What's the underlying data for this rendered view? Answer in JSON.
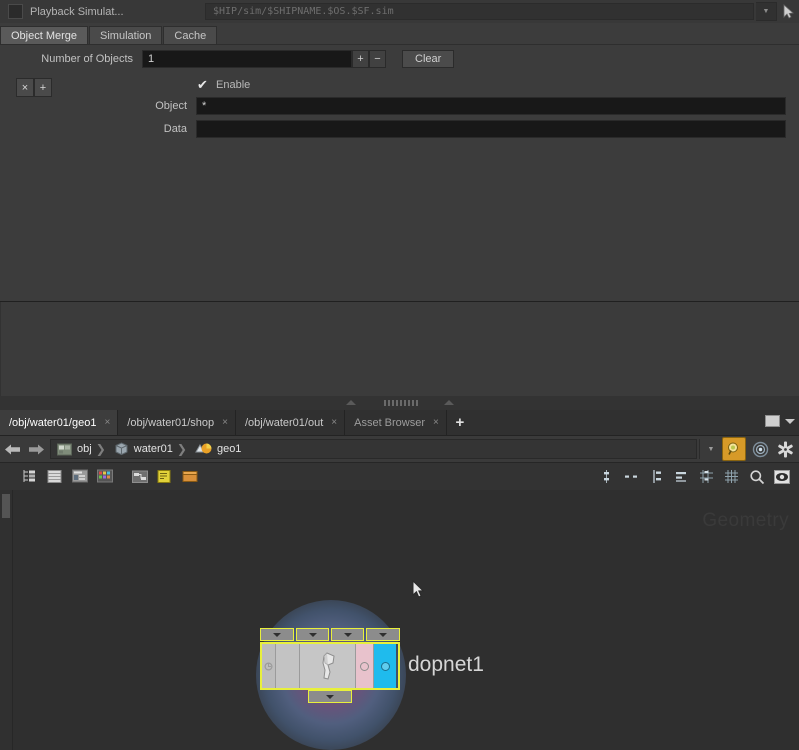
{
  "parameter_editor": {
    "node": {
      "color_swatch": "#2b2b2b",
      "name": "Playback Simulat...",
      "path_value": "$HIP/sim/$SHIPNAME.$OS.$SF.sim",
      "dropdown_icon": "chevron-down-icon",
      "picker_icon": "node-picker-icon"
    },
    "tabs": [
      {
        "label": "Object Merge",
        "active": true
      },
      {
        "label": "Simulation",
        "active": false
      },
      {
        "label": "Cache",
        "active": false
      }
    ],
    "rows": {
      "number_of_objects": {
        "label": "Number of Objects",
        "value": "1",
        "increment_label": "+",
        "decrement_label": "−",
        "clear_label": "Clear"
      },
      "multiparm": {
        "remove_label": "×",
        "add_label": "+"
      },
      "enable": {
        "label": "Enable",
        "checked_glyph": "✔",
        "checked": true
      },
      "object": {
        "label": "Object",
        "value": "*"
      },
      "data": {
        "label": "Data",
        "value": ""
      }
    }
  },
  "network_editor": {
    "tabs": [
      {
        "label": "/obj/water01/geo1",
        "active": true,
        "close_glyph": "×"
      },
      {
        "label": "/obj/water01/shop",
        "active": false,
        "close_glyph": "×"
      },
      {
        "label": "/obj/water01/out",
        "active": false,
        "close_glyph": "×"
      },
      {
        "label": "Asset Browser",
        "active": false,
        "close_glyph": "×"
      }
    ],
    "new_tab_label": "+",
    "window_controls": {
      "maximize_icon": "maximize-icon",
      "menu_icon": "chevron-down-icon"
    },
    "path_bar": {
      "back_icon": "arrow-left-icon",
      "forward_icon": "arrow-right-icon",
      "breadcrumb": [
        {
          "label": "obj",
          "icon": "obj-network-icon"
        },
        {
          "label": "water01",
          "icon": "geometry-object-icon"
        },
        {
          "label": "geo1",
          "icon": "geometry-node-icon"
        }
      ],
      "separator": "❯",
      "dropdown_icon": "chevron-down-icon",
      "right_icons": [
        {
          "name": "node-snapshot-icon",
          "selected": true
        },
        {
          "name": "display-options-icon",
          "selected": false
        },
        {
          "name": "gear-icon",
          "selected": false
        }
      ]
    },
    "toolbar": {
      "left_icons": [
        "tree-view-icon",
        "list-view-icon",
        "parameter-panel-icon",
        "color-palette-icon",
        "node-layout-icon",
        "notes-icon",
        "box-icon"
      ],
      "right_icons": [
        "snap-point-icon",
        "snap-dash-icon",
        "align-vertical-icon",
        "align-horizontal-icon",
        "grid-snap-icon",
        "grid-icon",
        "search-icon",
        "view-icon"
      ]
    },
    "canvas": {
      "watermark": "Geometry",
      "cursor_icon": "mouse-pointer-icon",
      "nodes": [
        {
          "name": "dopnet1",
          "selected": true,
          "selection_color": "#e8f03c",
          "display_flag_color": "#1fbbed",
          "body_color": "#c3c3c3",
          "bypass_color": "#e8c2cc",
          "halo_colors": [
            "#965f96",
            "#5f73a0"
          ],
          "input_tab_count": 4,
          "output_tab_count": 1,
          "tab_glyph": "▼"
        }
      ]
    }
  }
}
